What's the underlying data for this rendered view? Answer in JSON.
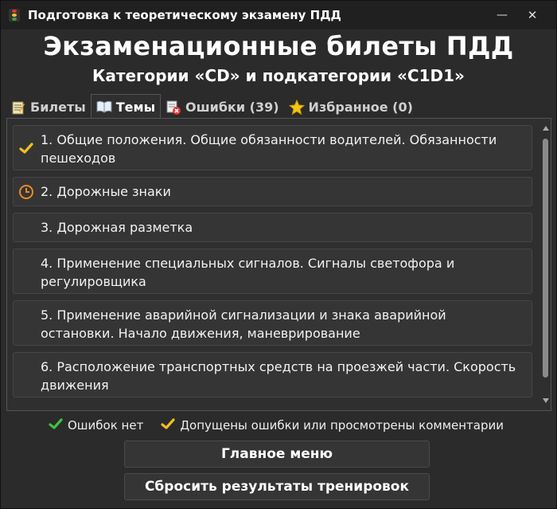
{
  "window": {
    "title": "Подготовка к теоретическому экзамену ПДД",
    "minimize_glyph": "—",
    "close_glyph": "✕"
  },
  "header": {
    "title": "Экзаменационные билеты ПДД",
    "subtitle": "Категории «CD» и подкатегории «C1D1»"
  },
  "tabs": [
    {
      "label": "Билеты",
      "icon": "notepad-icon",
      "active": false
    },
    {
      "label": "Темы",
      "icon": "open-book-icon",
      "active": true
    },
    {
      "label": "Ошибки (39)",
      "icon": "error-list-icon",
      "active": false
    },
    {
      "label": "Избранное (0)",
      "icon": "star-icon",
      "active": false
    }
  ],
  "topics": [
    {
      "label": "1. Общие положения. Общие обязанности водителей. Обязанности пешеходов",
      "status": "checkmark-yellow-icon"
    },
    {
      "label": "2. Дорожные знаки",
      "status": "clock-icon"
    },
    {
      "label": "3. Дорожная разметка",
      "status": ""
    },
    {
      "label": "4. Применение специальных сигналов. Сигналы светофора и регулировщика",
      "status": ""
    },
    {
      "label": "5. Применение аварийной сигнализации и знака аварийной остановки. Начало движения, маневрирование",
      "status": ""
    },
    {
      "label": "6. Расположение транспортных средств на проезжей части. Скорость движения",
      "status": ""
    }
  ],
  "legend": {
    "no_errors": "Ошибок нет",
    "with_errors": "Допущены ошибки или просмотрены комментарии"
  },
  "buttons": {
    "main_menu": "Главное меню",
    "reset": "Сбросить результаты тренировок"
  },
  "colors": {
    "green_check": "#3ec43e",
    "yellow_check": "#f0c020",
    "clock": "#e8892b",
    "star": "#f5c518"
  }
}
